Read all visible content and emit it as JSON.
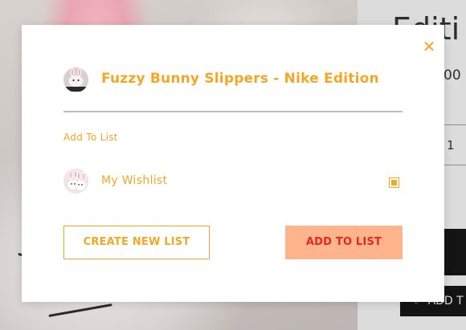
{
  "background_page": {
    "title_fragment": "Editi",
    "price_fragment": "00",
    "quantity": "1",
    "add_to_button_fragment": "ADD T"
  },
  "modal": {
    "product": {
      "title": "Fuzzy Bunny Slippers - Nike Edition",
      "thumbnail_icon": "bunny-slippers-thumbnail"
    },
    "section_label": "Add To List",
    "lists": [
      {
        "name": "My Wishlist",
        "checked": true,
        "thumbnail_icon": "bunny-slippers-thumbnail"
      }
    ],
    "buttons": {
      "create_new_list": "CREATE NEW LIST",
      "add_to_list": "ADD TO LIST"
    },
    "close_icon": "close-icon"
  },
  "colors": {
    "accent": "#f5a623",
    "add_button_bg": "#ffb48c",
    "add_button_text": "#e8261c",
    "divider": "#bdbdbd"
  }
}
